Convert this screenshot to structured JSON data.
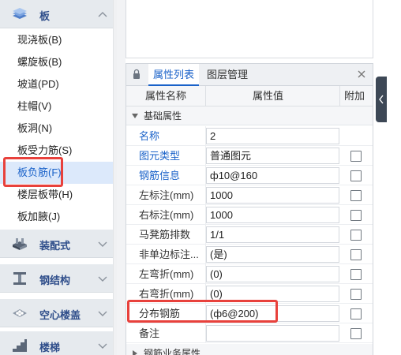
{
  "sidebar": {
    "top_category": {
      "label": "板",
      "icon": "slab-icon",
      "expanded": true
    },
    "items": [
      {
        "label": "现浇板(B)"
      },
      {
        "label": "螺旋板(B)"
      },
      {
        "label": "坡道(PD)"
      },
      {
        "label": "柱帽(V)"
      },
      {
        "label": "板洞(N)"
      },
      {
        "label": "板受力筋(S)"
      },
      {
        "label": "板负筋(F)",
        "selected": true
      },
      {
        "label": "楼层板带(H)"
      },
      {
        "label": "板加腋(J)"
      }
    ],
    "categories": [
      {
        "label": "装配式",
        "icon": "prefab-icon"
      },
      {
        "label": "钢结构",
        "icon": "steel-structure-icon"
      },
      {
        "label": "空心楼盖",
        "icon": "hollow-floor-icon"
      },
      {
        "label": "楼梯",
        "icon": "stairs-icon"
      }
    ]
  },
  "properties": {
    "tabs": [
      {
        "label": "属性列表",
        "active": true
      },
      {
        "label": "图层管理",
        "active": false
      }
    ],
    "close_icon": "close-icon",
    "columns": {
      "name": "属性名称",
      "value": "属性值",
      "append": "附加"
    },
    "group_basic": "基础属性",
    "rows": [
      {
        "name": "名称",
        "value": "2",
        "blue": true,
        "checkbox": false
      },
      {
        "name": "图元类型",
        "value": "普通图元",
        "blue": true,
        "checkbox": true
      },
      {
        "name": "钢筋信息",
        "value": "ф10@160",
        "blue": true,
        "checkbox": true
      },
      {
        "name": "左标注(mm)",
        "value": "1000",
        "blue": false,
        "checkbox": true
      },
      {
        "name": "右标注(mm)",
        "value": "1000",
        "blue": false,
        "checkbox": true
      },
      {
        "name": "马凳筋排数",
        "value": "1/1",
        "blue": false,
        "checkbox": true
      },
      {
        "name": "非单边标注...",
        "value": "(是)",
        "blue": false,
        "checkbox": true
      },
      {
        "name": "左弯折(mm)",
        "value": "(0)",
        "blue": false,
        "checkbox": true
      },
      {
        "name": "右弯折(mm)",
        "value": "(0)",
        "blue": false,
        "checkbox": true
      },
      {
        "name": "分布钢筋",
        "value": "(ф6@200)",
        "blue": false,
        "checkbox": true
      },
      {
        "name": "备注",
        "value": "",
        "blue": false,
        "checkbox": true
      }
    ],
    "group_rebar": "钢筋业务属性"
  },
  "colors": {
    "accent": "#1a62c9",
    "annotation": "#e8413c",
    "selected_bg": "#dce9fb"
  }
}
